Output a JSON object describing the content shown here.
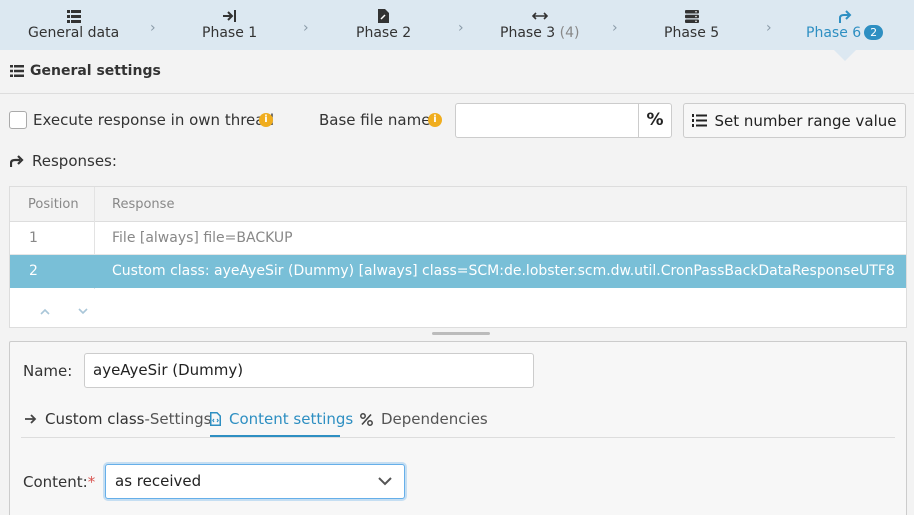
{
  "phase_nav": {
    "tabs": [
      {
        "label": "General data",
        "icon": "list-icon"
      },
      {
        "label": "Phase 1",
        "icon": "arrow-to-right-icon"
      },
      {
        "label": "Phase 2",
        "icon": "file-edit-icon"
      },
      {
        "label": "Phase 3",
        "count": "(4)",
        "icon": "left-right-arrows-icon"
      },
      {
        "label": "Phase 5",
        "icon": "server-icon"
      },
      {
        "label": "Phase 6",
        "badge": "2",
        "icon": "share-arrow-icon"
      }
    ]
  },
  "general_settings": {
    "title": "General settings",
    "execute_label": "Execute response in own thread",
    "base_file_label": "Base file name:",
    "base_file_value": "",
    "percent_button": "%",
    "range_button": "Set number range value",
    "responses_label": "Responses:"
  },
  "table": {
    "headers": [
      "Position",
      "Response"
    ],
    "rows": [
      {
        "position": "1",
        "response": "File [always] file=BACKUP"
      },
      {
        "position": "2",
        "response": "Custom class: ayeAyeSir (Dummy) [always] class=SCM:de.lobster.scm.dw.util.CronPassBackDataResponseUTF8"
      }
    ]
  },
  "detail": {
    "name_label": "Name:",
    "name_value": "ayeAyeSir (Dummy)",
    "tabs": [
      {
        "strong": "Custom class",
        "rest": "-Settings"
      },
      {
        "label": "Content settings"
      },
      {
        "label": "Dependencies"
      }
    ],
    "content_label": "Content:",
    "required_mark": "*",
    "content_value": "as received"
  },
  "colors": {
    "accent": "#2e8fc2",
    "selected_row": "#79bfd7",
    "nav_bg": "#dce8f1",
    "info": "#f0ad1e"
  }
}
